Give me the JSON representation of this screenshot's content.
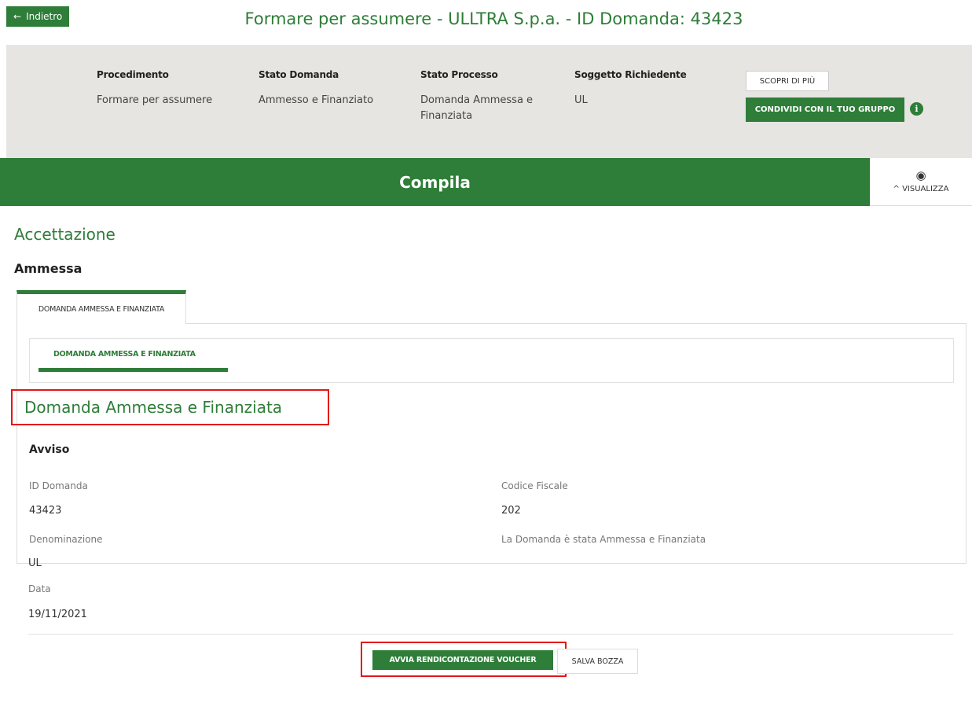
{
  "header": {
    "back_label": "Indietro",
    "back_arrow": "←",
    "title": "Formare per assumere - ULLTRA S.p.a. - ID Domanda: 43423"
  },
  "info_bar": {
    "columns": [
      {
        "label": "Procedimento",
        "value": "Formare per assumere"
      },
      {
        "label": "Stato Domanda",
        "value": "Ammesso e Finanziato"
      },
      {
        "label": "Stato Processo",
        "value": "Domanda Ammessa e Finanziata"
      },
      {
        "label": "Soggetto Richiedente",
        "value": "UL"
      }
    ],
    "scopri_label": "SCOPRI DI PIÙ",
    "share_label": "CONDIVIDI CON IL TUO GRUPPO",
    "info_icon": "i"
  },
  "compila": {
    "label": "Compila",
    "visualizza_label": "VISUALIZZA",
    "eye_icon": "◉",
    "chevron": "^"
  },
  "section": {
    "title": "Accettazione",
    "subtitle": "Ammessa",
    "tab_label": "DOMANDA AMMESSA E FINANZIATA",
    "inner_tab_label": "DOMANDA AMMESSA E FINANZIATA",
    "form_title": "Domanda Ammessa e Finanziata",
    "group_title": "Avviso"
  },
  "fields": {
    "id_label": "ID Domanda",
    "id_value": "43423",
    "cf_label": "Codice Fiscale",
    "cf_value": "202",
    "den_label": "Denominazione",
    "den_value": "UL",
    "msg_label": "La Domanda è stata Ammessa e Finanziata",
    "date_label": "Data",
    "date_value": "19/11/2021"
  },
  "actions": {
    "avvia_label": "AVVIA RENDICONTAZIONE VOUCHER",
    "salva_label": "SALVA BOZZA"
  },
  "colors": {
    "primary": "#2e7d38",
    "highlight": "#e3161b",
    "info_bg": "#e6e5e1"
  }
}
